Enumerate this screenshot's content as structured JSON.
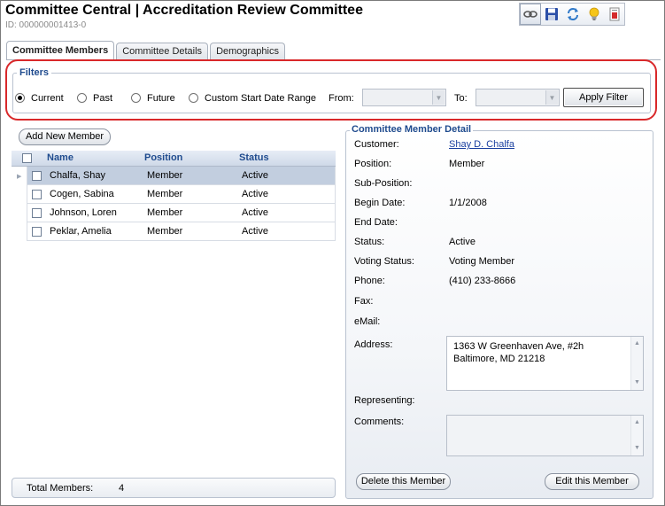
{
  "header": {
    "title": "Committee Central  |  Accreditation Review Committee",
    "id_text": "ID: 000000001413-0"
  },
  "toolbar": {
    "icons": [
      "link-icon",
      "save-icon",
      "refresh-icon",
      "lightbulb-icon",
      "report-icon"
    ]
  },
  "tabs": [
    {
      "label": "Committee Members",
      "active": true
    },
    {
      "label": "Committee Details",
      "active": false
    },
    {
      "label": "Demographics",
      "active": false
    }
  ],
  "filters": {
    "legend": "Filters",
    "options": [
      {
        "label": "Current",
        "checked": true
      },
      {
        "label": "Past",
        "checked": false
      },
      {
        "label": "Future",
        "checked": false
      },
      {
        "label": "Custom Start Date Range",
        "checked": false
      }
    ],
    "from_label": "From:",
    "from_value": "",
    "to_label": "To:",
    "to_value": "",
    "apply_label": "Apply Filter"
  },
  "members": {
    "add_button": "Add New Member",
    "columns": [
      "Name",
      "Position",
      "Status"
    ],
    "rows": [
      {
        "name": "Chalfa, Shay",
        "position": "Member",
        "status": "Active",
        "selected": true
      },
      {
        "name": "Cogen, Sabina",
        "position": "Member",
        "status": "Active",
        "selected": false
      },
      {
        "name": "Johnson, Loren",
        "position": "Member",
        "status": "Active",
        "selected": false
      },
      {
        "name": "Peklar, Amelia",
        "position": "Member",
        "status": "Active",
        "selected": false
      }
    ],
    "total_label": "Total Members:",
    "total_value": "4"
  },
  "detail": {
    "legend": "Committee Member Detail",
    "customer_label": "Customer:",
    "customer_value": "Shay D. Chalfa",
    "position_label": "Position:",
    "position_value": "Member",
    "subposition_label": "Sub-Position:",
    "subposition_value": "",
    "begin_label": "Begin Date:",
    "begin_value": "1/1/2008",
    "end_label": "End Date:",
    "end_value": "",
    "status_label": "Status:",
    "status_value": "Active",
    "voting_label": "Voting Status:",
    "voting_value": "Voting Member",
    "phone_label": "Phone:",
    "phone_value": "(410) 233-8666",
    "fax_label": "Fax:",
    "fax_value": "",
    "email_label": "eMail:",
    "email_value": "",
    "address_label": "Address:",
    "address_value": "1363 W Greenhaven Ave, #2h\nBaltimore, MD 21218",
    "representing_label": "Representing:",
    "representing_value": "",
    "comments_label": "Comments:",
    "comments_value": "",
    "delete_button": "Delete this Member",
    "edit_button": "Edit this Member"
  },
  "colors": {
    "accent_blue": "#1f4b8e",
    "selected_row": "#c2cedf",
    "highlight_red": "#d9282a",
    "link": "#1a3fa0"
  }
}
